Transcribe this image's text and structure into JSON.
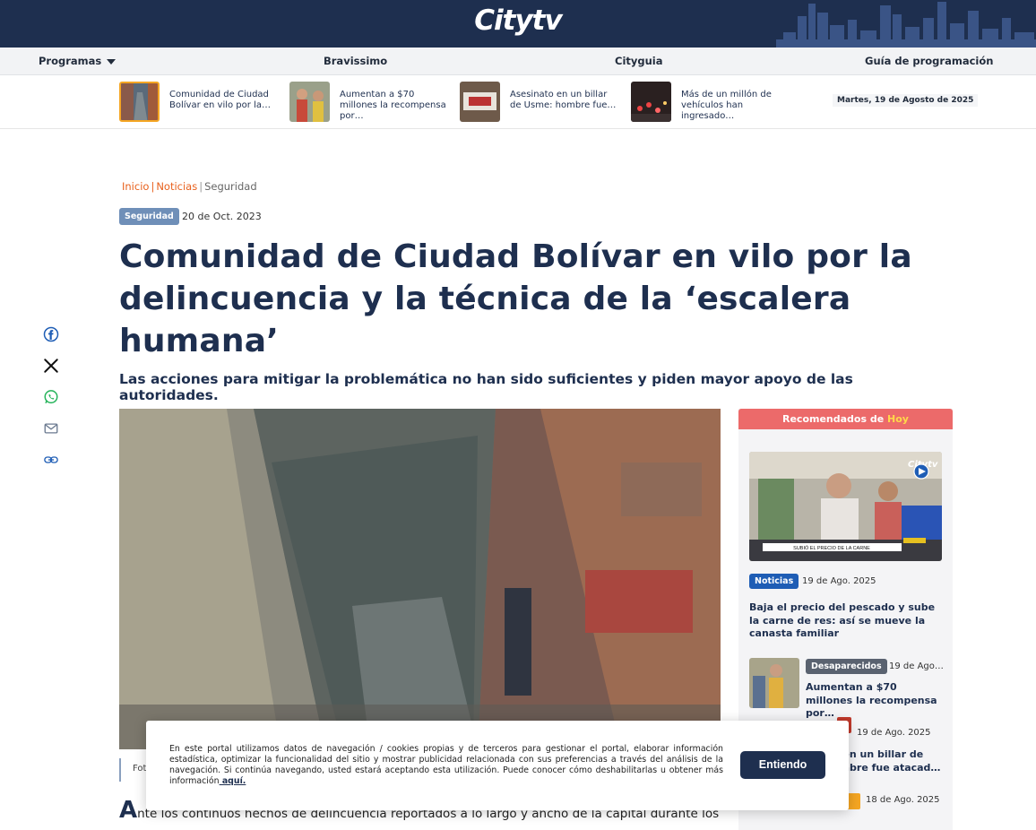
{
  "brand": {
    "logo": "Citytv"
  },
  "nav": {
    "programas": "Programas",
    "bravissimo": "Bravissimo",
    "cityguia": "Cityguia",
    "guia": "Guía de programación"
  },
  "ticker": {
    "items": [
      {
        "text": "Comunidad de Ciudad Bolívar en vilo por la…"
      },
      {
        "text": "Aumentan a $70 millones la recompensa por…"
      },
      {
        "text": "Asesinato en un billar de Usme: hombre fue…"
      },
      {
        "text": "Más de un millón de vehículos han ingresado…"
      }
    ],
    "date": "Martes, 19 de Agosto de 2025"
  },
  "breadcrumb": {
    "inicio": "Inicio",
    "noticias": "Noticias",
    "seguridad": "Seguridad"
  },
  "article": {
    "category": "Seguridad",
    "date": "20 de Oct. 2023",
    "title": "Comunidad de Ciudad Bolívar en vilo por la delincuencia y la técnica de la ‘escalera humana’",
    "subtitle": "Las acciones para mitigar la problemática no han sido suficientes y piden mayor apoyo de las autoridades.",
    "caption": "Fot",
    "lead_drop": "A",
    "lead": "nte los continuos hechos de delincuencia reportados a lo largo y ancho de la capital durante los"
  },
  "share": [
    "facebook-icon",
    "x-icon",
    "whatsapp-icon",
    "mail-icon",
    "link-icon"
  ],
  "sidebar": {
    "header": "Recomendados de",
    "header_hl": "Hoy",
    "main": {
      "badge": "Noticias",
      "date": "19 de Ago. 2025",
      "title": "Baja el precio del pescado y sube la carne de res: así se mueve la canasta familiar",
      "img_caption": "SUBIÓ EL PRECIO DE LA CARNE"
    },
    "items": [
      {
        "badge": "Desaparecidos",
        "date": "19 de Ago…",
        "title": "Aumentan a $70 millones la recompensa por…"
      },
      {
        "date": "19 de Ago. 2025",
        "title": "o en un billar de ombre fue atacad…"
      },
      {
        "date": "18 de Ago. 2025"
      }
    ]
  },
  "cookie": {
    "text": "En este portal utilizamos datos de navegación / cookies propias y de terceros para gestionar el portal, elaborar información estadística, optimizar la funcionalidad del sitio y mostrar publicidad relacionada con sus preferencias a través del análisis de la navegación. Si continúa navegando, usted estará aceptando esta utilización. Puede conocer cómo deshabilitarlas u obtener más información",
    "link": " aquí.",
    "button": "Entiendo"
  },
  "colors": {
    "navy": "#1e2f4f",
    "orange": "#e8601c",
    "coral": "#ec6a6a",
    "badge_blue": "#1e5db5"
  }
}
